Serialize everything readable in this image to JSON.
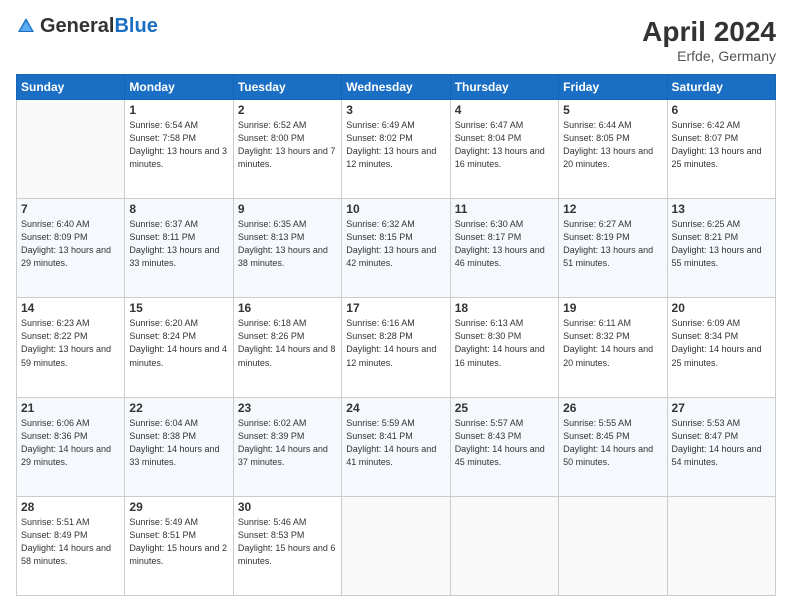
{
  "header": {
    "logo_general": "General",
    "logo_blue": "Blue",
    "month_title": "April 2024",
    "location": "Erfde, Germany"
  },
  "weekdays": [
    "Sunday",
    "Monday",
    "Tuesday",
    "Wednesday",
    "Thursday",
    "Friday",
    "Saturday"
  ],
  "weeks": [
    [
      {
        "day": null
      },
      {
        "day": "1",
        "sunrise": "6:54 AM",
        "sunset": "7:58 PM",
        "daylight": "13 hours and 3 minutes."
      },
      {
        "day": "2",
        "sunrise": "6:52 AM",
        "sunset": "8:00 PM",
        "daylight": "13 hours and 7 minutes."
      },
      {
        "day": "3",
        "sunrise": "6:49 AM",
        "sunset": "8:02 PM",
        "daylight": "13 hours and 12 minutes."
      },
      {
        "day": "4",
        "sunrise": "6:47 AM",
        "sunset": "8:04 PM",
        "daylight": "13 hours and 16 minutes."
      },
      {
        "day": "5",
        "sunrise": "6:44 AM",
        "sunset": "8:05 PM",
        "daylight": "13 hours and 20 minutes."
      },
      {
        "day": "6",
        "sunrise": "6:42 AM",
        "sunset": "8:07 PM",
        "daylight": "13 hours and 25 minutes."
      }
    ],
    [
      {
        "day": "7",
        "sunrise": "6:40 AM",
        "sunset": "8:09 PM",
        "daylight": "13 hours and 29 minutes."
      },
      {
        "day": "8",
        "sunrise": "6:37 AM",
        "sunset": "8:11 PM",
        "daylight": "13 hours and 33 minutes."
      },
      {
        "day": "9",
        "sunrise": "6:35 AM",
        "sunset": "8:13 PM",
        "daylight": "13 hours and 38 minutes."
      },
      {
        "day": "10",
        "sunrise": "6:32 AM",
        "sunset": "8:15 PM",
        "daylight": "13 hours and 42 minutes."
      },
      {
        "day": "11",
        "sunrise": "6:30 AM",
        "sunset": "8:17 PM",
        "daylight": "13 hours and 46 minutes."
      },
      {
        "day": "12",
        "sunrise": "6:27 AM",
        "sunset": "8:19 PM",
        "daylight": "13 hours and 51 minutes."
      },
      {
        "day": "13",
        "sunrise": "6:25 AM",
        "sunset": "8:21 PM",
        "daylight": "13 hours and 55 minutes."
      }
    ],
    [
      {
        "day": "14",
        "sunrise": "6:23 AM",
        "sunset": "8:22 PM",
        "daylight": "13 hours and 59 minutes."
      },
      {
        "day": "15",
        "sunrise": "6:20 AM",
        "sunset": "8:24 PM",
        "daylight": "14 hours and 4 minutes."
      },
      {
        "day": "16",
        "sunrise": "6:18 AM",
        "sunset": "8:26 PM",
        "daylight": "14 hours and 8 minutes."
      },
      {
        "day": "17",
        "sunrise": "6:16 AM",
        "sunset": "8:28 PM",
        "daylight": "14 hours and 12 minutes."
      },
      {
        "day": "18",
        "sunrise": "6:13 AM",
        "sunset": "8:30 PM",
        "daylight": "14 hours and 16 minutes."
      },
      {
        "day": "19",
        "sunrise": "6:11 AM",
        "sunset": "8:32 PM",
        "daylight": "14 hours and 20 minutes."
      },
      {
        "day": "20",
        "sunrise": "6:09 AM",
        "sunset": "8:34 PM",
        "daylight": "14 hours and 25 minutes."
      }
    ],
    [
      {
        "day": "21",
        "sunrise": "6:06 AM",
        "sunset": "8:36 PM",
        "daylight": "14 hours and 29 minutes."
      },
      {
        "day": "22",
        "sunrise": "6:04 AM",
        "sunset": "8:38 PM",
        "daylight": "14 hours and 33 minutes."
      },
      {
        "day": "23",
        "sunrise": "6:02 AM",
        "sunset": "8:39 PM",
        "daylight": "14 hours and 37 minutes."
      },
      {
        "day": "24",
        "sunrise": "5:59 AM",
        "sunset": "8:41 PM",
        "daylight": "14 hours and 41 minutes."
      },
      {
        "day": "25",
        "sunrise": "5:57 AM",
        "sunset": "8:43 PM",
        "daylight": "14 hours and 45 minutes."
      },
      {
        "day": "26",
        "sunrise": "5:55 AM",
        "sunset": "8:45 PM",
        "daylight": "14 hours and 50 minutes."
      },
      {
        "day": "27",
        "sunrise": "5:53 AM",
        "sunset": "8:47 PM",
        "daylight": "14 hours and 54 minutes."
      }
    ],
    [
      {
        "day": "28",
        "sunrise": "5:51 AM",
        "sunset": "8:49 PM",
        "daylight": "14 hours and 58 minutes."
      },
      {
        "day": "29",
        "sunrise": "5:49 AM",
        "sunset": "8:51 PM",
        "daylight": "15 hours and 2 minutes."
      },
      {
        "day": "30",
        "sunrise": "5:46 AM",
        "sunset": "8:53 PM",
        "daylight": "15 hours and 6 minutes."
      },
      {
        "day": null
      },
      {
        "day": null
      },
      {
        "day": null
      },
      {
        "day": null
      }
    ]
  ]
}
